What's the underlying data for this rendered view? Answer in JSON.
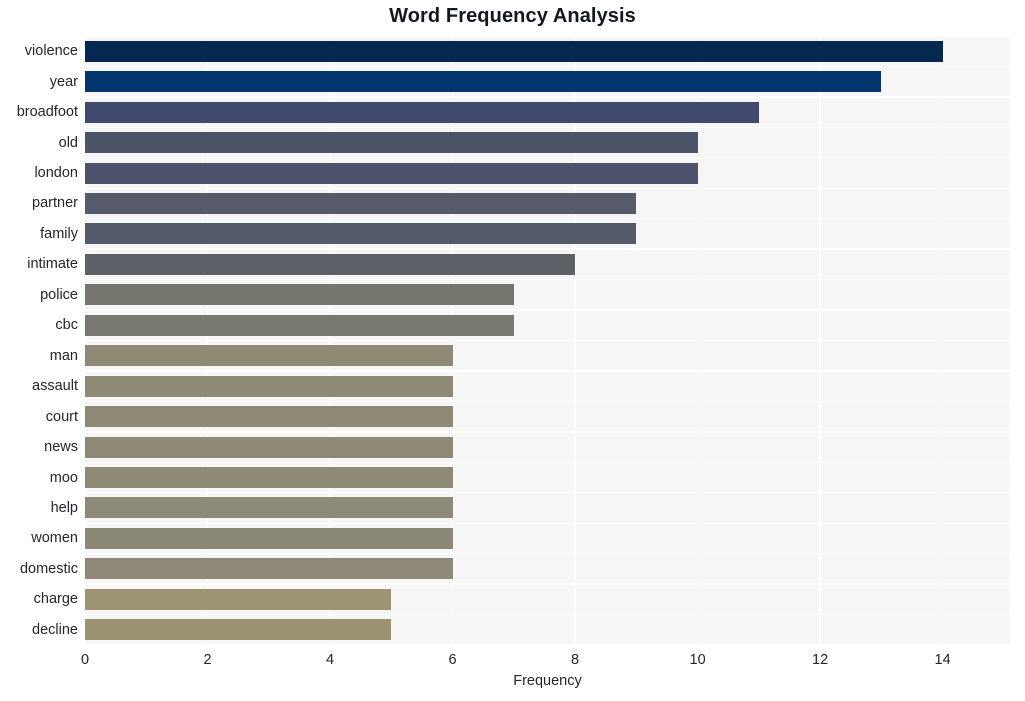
{
  "chart_data": {
    "type": "bar",
    "orientation": "horizontal",
    "title": "Word Frequency Analysis",
    "xlabel": "Frequency",
    "ylabel": "",
    "categories": [
      "violence",
      "year",
      "broadfoot",
      "old",
      "london",
      "partner",
      "family",
      "intimate",
      "police",
      "cbc",
      "man",
      "assault",
      "court",
      "news",
      "moo",
      "help",
      "women",
      "domestic",
      "charge",
      "decline"
    ],
    "values": [
      14,
      13,
      11,
      10,
      10,
      9,
      9,
      8,
      7,
      7,
      6,
      6,
      6,
      6,
      6,
      6,
      6,
      6,
      5,
      5
    ],
    "bar_colors": [
      "#042850",
      "#03356f",
      "#3f4a6e",
      "#4c5468",
      "#4b5269",
      "#555b6b",
      "#555a6a",
      "#5e6068",
      "#76766f",
      "#787871",
      "#8e8a76",
      "#8d8a76",
      "#8d8975",
      "#8d8975",
      "#8d8a76",
      "#8e8a77",
      "#8b8776",
      "#8e8a77",
      "#9d9474",
      "#9c9373"
    ],
    "xlim": [
      0,
      15.1
    ],
    "xticks": [
      0,
      2,
      4,
      6,
      8,
      10,
      12,
      14
    ],
    "xtick_labels": [
      "0",
      "2",
      "4",
      "6",
      "8",
      "10",
      "12",
      "14"
    ],
    "grid": true,
    "grid_color": "#ffffff",
    "plot_background": "#f6f6f7",
    "figure_background": "#ffffff",
    "legend": null
  }
}
